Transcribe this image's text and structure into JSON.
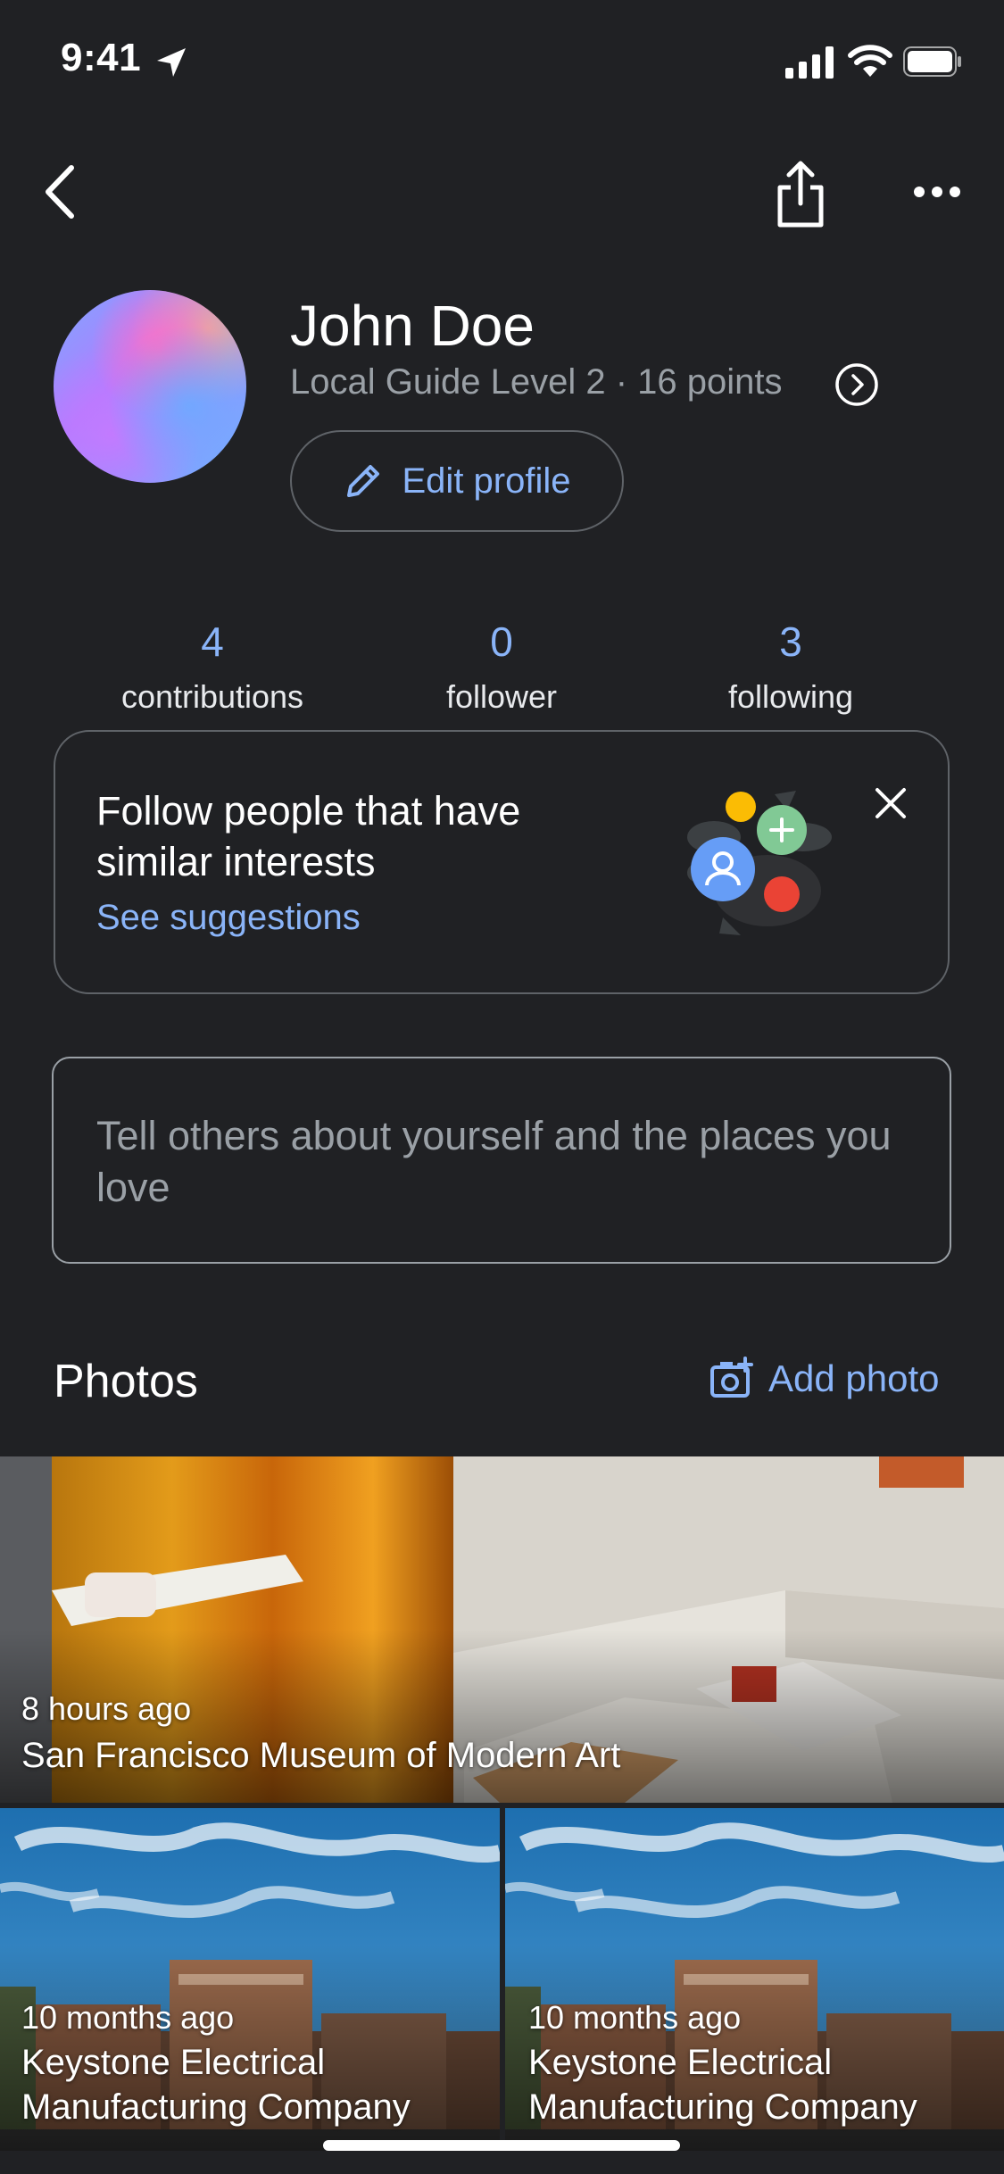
{
  "status_bar": {
    "time": "9:41"
  },
  "profile": {
    "name": "John Doe",
    "level": "Local Guide Level 2 · 16 points",
    "edit_label": "Edit profile"
  },
  "stats": [
    {
      "value": "4",
      "label": "contributions"
    },
    {
      "value": "0",
      "label": "follower"
    },
    {
      "value": "3",
      "label": "following"
    }
  ],
  "follow_card": {
    "title": "Follow people that have similar interests",
    "link": "See suggestions"
  },
  "about": {
    "placeholder": "Tell others about yourself and the places you love"
  },
  "photos": {
    "title": "Photos",
    "add_label": "Add photo",
    "items": [
      {
        "time": "8 hours ago",
        "place": "San Francisco Museum of Modern Art"
      },
      {
        "time": "10 months ago",
        "place": "Keystone Electrical Manufacturing Company"
      },
      {
        "time": "10 months ago",
        "place": "Keystone Electrical Manufacturing Company"
      }
    ]
  },
  "colors": {
    "background": "#202124",
    "accent": "#8ab4f8",
    "muted": "#9aa0a6"
  }
}
